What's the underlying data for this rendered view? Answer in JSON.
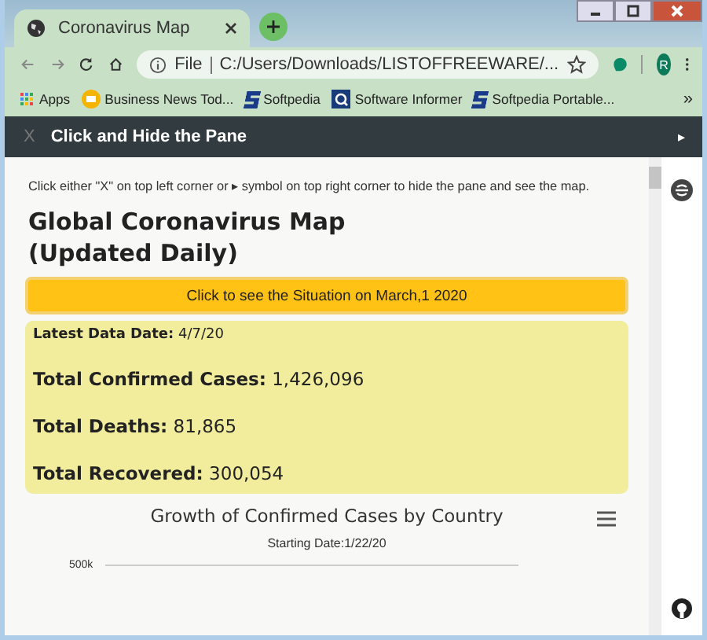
{
  "tabs": [
    {
      "title": "Coronavirus Map",
      "selected": true
    }
  ],
  "toolbar": {
    "scheme": "File",
    "url": "C:/Users/Downloads/LISTOFFREEWARE/...",
    "profile": "R"
  },
  "bookmarks": [
    {
      "label": "Apps",
      "kind": "apps"
    },
    {
      "label": "Business News Tod...",
      "kind": "news"
    },
    {
      "label": "Softpedia",
      "kind": "s"
    },
    {
      "label": "Software Informer",
      "kind": "informer"
    },
    {
      "label": "Softpedia Portable...",
      "kind": "s"
    }
  ],
  "bookmarks_more": "»",
  "pane": {
    "close": "X",
    "title": "Click and Hide the Pane",
    "hint": "Click either \"X\" on top left corner or ▸ symbol on top right corner to hide the pane and see the map.",
    "heading": "Global Coronavirus Map (Updated Daily)",
    "button": "Click to see the Situation on March,1 2020",
    "stats": [
      {
        "label": "Latest Data Date:",
        "value": "4/7/20",
        "kind": "small"
      },
      {
        "label": "Total Confirmed Cases:",
        "value": "1,426,096",
        "kind": "large"
      },
      {
        "label": "Total Deaths:",
        "value": "81,865",
        "kind": "large"
      },
      {
        "label": "Total Recovered:",
        "value": "300,054",
        "kind": "large"
      }
    ],
    "chart": {
      "title": "Growth of Confirmed Cases by Country",
      "subtitle": "Starting Date:1/22/20",
      "ytick": "500k"
    }
  },
  "sidebar": {
    "toggle": "▸"
  }
}
